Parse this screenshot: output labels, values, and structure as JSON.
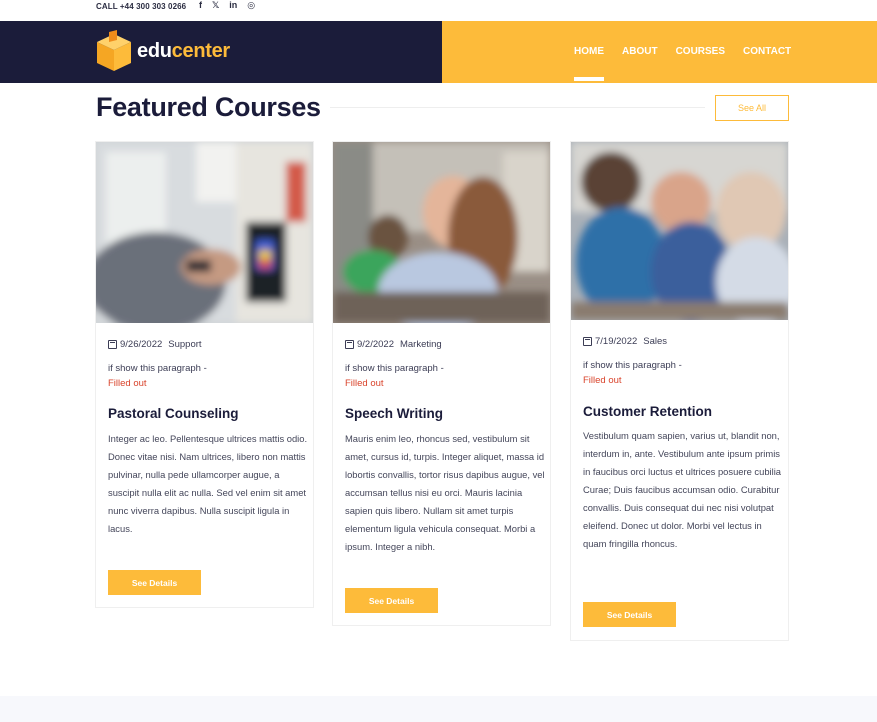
{
  "topbar": {
    "call": "CALL +44 300 303 0266",
    "social": [
      "f",
      "𝕏",
      "in",
      "◎"
    ],
    "social_names": [
      "facebook-icon",
      "twitter-icon",
      "linkedin-icon",
      "instagram-icon"
    ]
  },
  "brand": {
    "edu": "edu",
    "center": "center"
  },
  "nav": [
    {
      "label": "HOME",
      "active": true
    },
    {
      "label": "ABOUT"
    },
    {
      "label": "COURSES"
    },
    {
      "label": "CONTACT"
    }
  ],
  "section": {
    "title": "Featured Courses",
    "see_all": "See All"
  },
  "courses": [
    {
      "date": "9/26/2022",
      "category": "Support",
      "paragraph": "if show this paragraph -",
      "status": "Filled out",
      "title": "Pastoral Counseling",
      "description": "Integer ac leo. Pellentesque ultrices mattis odio. Donec vitae nisi. Nam ultrices, libero non mattis pulvinar, nulla pede ullamcorper augue, a suscipit nulla elit ac nulla. Sed vel enim sit amet nunc viverra dapibus. Nulla suscipit ligula in lacus.",
      "button": "See Details"
    },
    {
      "date": "9/2/2022",
      "category": "Marketing",
      "paragraph": "if show this paragraph -",
      "status": "Filled out",
      "title": "Speech Writing",
      "description": "Mauris enim leo, rhoncus sed, vestibulum sit amet, cursus id, turpis. Integer aliquet, massa id lobortis convallis, tortor risus dapibus augue, vel accumsan tellus nisi eu orci. Mauris lacinia sapien quis libero. Nullam sit amet turpis elementum ligula vehicula consequat. Morbi a ipsum. Integer a nibh.",
      "button": "See Details"
    },
    {
      "date": "7/19/2022",
      "category": "Sales",
      "paragraph": "if show this paragraph -",
      "status": "Filled out",
      "title": "Customer Retention",
      "description": "Vestibulum quam sapien, varius ut, blandit non, interdum in, ante. Vestibulum ante ipsum primis in faucibus orci luctus et ultrices posuere cubilia Curae; Duis faucibus accumsan odio. Curabitur convallis. Duis consequat dui nec nisi volutpat eleifend. Donec ut dolor. Morbi vel lectus in quam fringilla rhoncus.",
      "button": "See Details"
    }
  ],
  "colors": {
    "navy": "#1b1c3a",
    "accent": "#fdbb3a",
    "status": "#d9432b"
  }
}
